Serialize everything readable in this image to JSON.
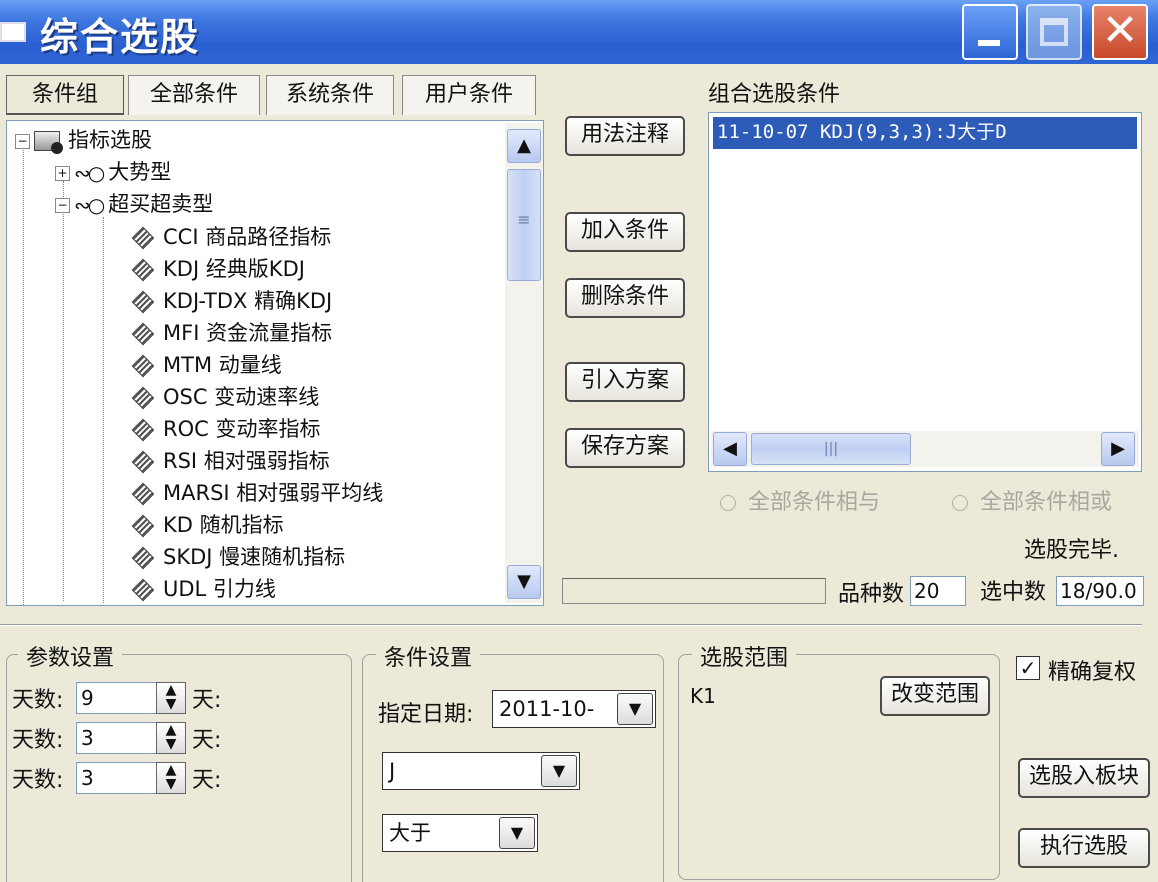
{
  "window": {
    "title": "综合选股"
  },
  "tabs": [
    "条件组",
    "全部条件",
    "系统条件",
    "用户条件"
  ],
  "tree": {
    "root": "指标选股",
    "groups": [
      "大势型",
      "超买超卖型"
    ],
    "items": [
      "CCI 商品路径指标",
      "KDJ 经典版KDJ",
      "KDJ-TDX 精确KDJ",
      "MFI 资金流量指标",
      "MTM 动量线",
      "OSC 变动速率线",
      "ROC 变动率指标",
      "RSI 相对强弱指标",
      "MARSI 相对强弱平均线",
      "KD 随机指标",
      "SKDJ 慢速随机指标",
      "UDL 引力线"
    ]
  },
  "buttons": {
    "usage": "用法注释",
    "add": "加入条件",
    "delete": "删除条件",
    "import": "引入方案",
    "save": "保存方案",
    "change_range": "改变范围",
    "to_block": "选股入板块",
    "run": "执行选股"
  },
  "conditions": {
    "label": "组合选股条件",
    "items": [
      "11-10-07 KDJ(9,3,3):J大于D"
    ]
  },
  "radios": {
    "and": "全部条件相与",
    "or": "全部条件相或"
  },
  "status": {
    "done": "选股完毕.",
    "count_label": "品种数",
    "count_value": "20",
    "selected_label": "选中数",
    "selected_value": "18/90.0"
  },
  "params": {
    "title": "参数设置",
    "rows": [
      {
        "label": "天数:",
        "value": "9",
        "unit": "天:"
      },
      {
        "label": "天数:",
        "value": "3",
        "unit": "天:"
      },
      {
        "label": "天数:",
        "value": "3",
        "unit": "天:"
      }
    ]
  },
  "cond_settings": {
    "title": "条件设置",
    "date_label": "指定日期:",
    "date_value": "2011-10-",
    "field_value": "J",
    "op_value": "大于"
  },
  "range": {
    "title": "选股范围",
    "value": "K1"
  },
  "exact": {
    "label": "精确复权",
    "checked": true
  }
}
